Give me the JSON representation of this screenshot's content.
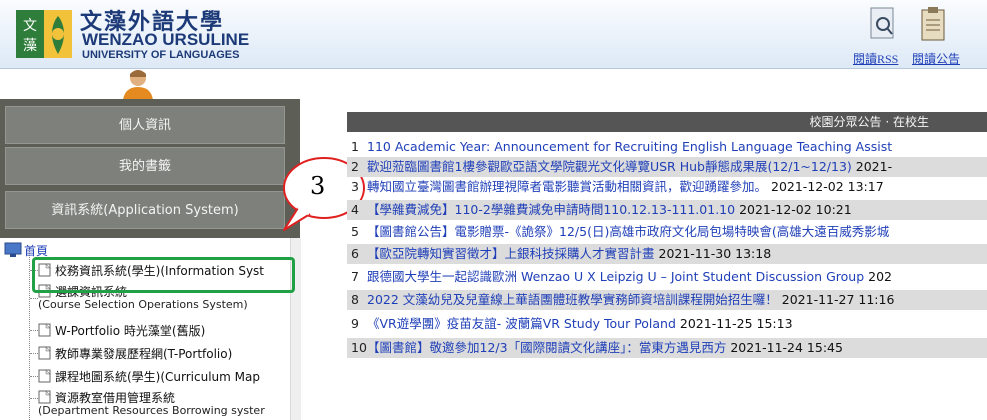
{
  "header": {
    "logo_cn": "文藻外語大學",
    "logo_en_line1": "WENZAO URSULINE",
    "logo_en_line2": "UNIVERSITY OF LANGUAGES",
    "links": [
      {
        "label": "閱讀RSS",
        "icon": "rss-document-icon"
      },
      {
        "label": "閱讀公告",
        "icon": "notice-board-icon"
      }
    ]
  },
  "sidebar": {
    "menu": [
      {
        "label": "個人資訊"
      },
      {
        "label": "我的書籤"
      },
      {
        "label": "資訊系統(Application System)"
      }
    ],
    "tree_root": "首頁",
    "tree_items": [
      {
        "label": "校務資訊系統(學生)(Information Syst"
      },
      {
        "label": "選課資訊系統",
        "sub": "(Course Selection Operations System)"
      },
      {
        "label": "W-Portfolio 時光藻堂(舊版)"
      },
      {
        "label": "教師專業發展歷程網(T-Portfolio)"
      },
      {
        "label": "課程地圖系統(學生)(Curriculum Map"
      },
      {
        "label": "資源教室借用管理系統",
        "sub": "(Department Resources Borrowing syster"
      }
    ]
  },
  "callout": {
    "number": "3"
  },
  "announcements": {
    "header": "校園分眾公告 · 在校生",
    "items": [
      {
        "num": "1",
        "title": "110 Academic Year: Announcement for Recruiting English Language Teaching Assist",
        "date": ""
      },
      {
        "num": "2",
        "title": "歡迎蒞臨圖書館1樓參觀歐亞語文學院觀光文化導覽USR Hub靜態成果展(12/1~12/13)",
        "date": "2021-"
      },
      {
        "num": "3",
        "title": "轉知國立臺灣圖書館辦理視障者電影聽賞活動相關資訊，歡迎踴躍參加。",
        "date": "2021-12-02 13:17"
      },
      {
        "num": "4",
        "title": "【學雜費減免】110-2學雜費減免申請時間110.12.13-111.01.10",
        "date": "2021-12-02 10:21"
      },
      {
        "num": "5",
        "title": "【圖書館公告】電影贈票-《詭祭》12/5(日)高雄市政府文化局包場特映會(高雄大遠百威秀影城",
        "date": ""
      },
      {
        "num": "6",
        "title": "【歐亞院轉知實習徵才】上銀科技採購人才實習計畫",
        "date": "2021-11-30 13:18"
      },
      {
        "num": "7",
        "title": "跟德國大學生一起認識歐洲 Wenzao U X Leipzig U – Joint Student Discussion Group",
        "date": "202"
      },
      {
        "num": "8",
        "title": "2022 文藻幼兒及兒童線上華語團體班教學實務師資培訓課程開始招生囉！",
        "date": "2021-11-27 11:16"
      },
      {
        "num": "9",
        "title": "《VR遊學團》疫苗友誼- 波蘭篇VR Study Tour Poland",
        "date": "2021-11-25 15:13"
      },
      {
        "num": "10",
        "title": "【圖書館】敬邀參加12/3「國際閱讀文化講座」：當東方遇見西方",
        "date": "2021-11-24 15:45"
      }
    ]
  }
}
